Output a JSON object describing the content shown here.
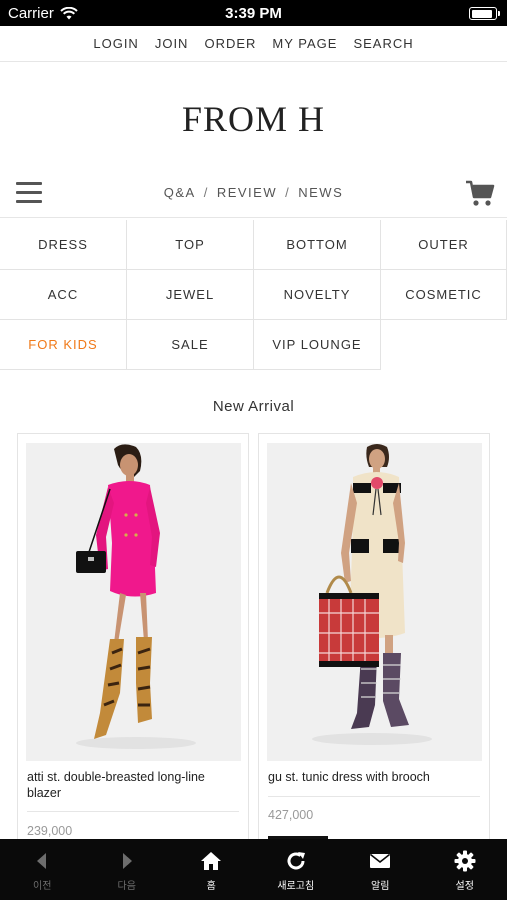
{
  "status_bar": {
    "carrier": "Carrier",
    "time": "3:39 PM",
    "battery_level": 0.9
  },
  "top_nav": [
    "LOGIN",
    "JOIN",
    "ORDER",
    "MY PAGE",
    "SEARCH"
  ],
  "logo": "FROM H",
  "sub_nav": {
    "links": [
      "Q&A",
      "REVIEW",
      "NEWS"
    ],
    "separator": "/"
  },
  "categories": [
    [
      "DRESS",
      "TOP",
      "BOTTOM",
      "OUTER"
    ],
    [
      "ACC",
      "JEWEL",
      "NOVELTY",
      "COSMETIC"
    ],
    [
      "FOR KIDS",
      "SALE",
      "VIP LOUNGE"
    ]
  ],
  "highlight_color": "#f07a1a",
  "section_title": "New Arrival",
  "products": [
    {
      "name": "atti st. double-breasted long-line blazer",
      "price": "239,000"
    },
    {
      "name": "gu st. tunic dress with brooch",
      "price": "427,000"
    }
  ],
  "toolbar": [
    {
      "icon": "back-arrow-icon",
      "label": "이전"
    },
    {
      "icon": "forward-arrow-icon",
      "label": "다음"
    },
    {
      "icon": "home-icon",
      "label": "홈"
    },
    {
      "icon": "refresh-icon",
      "label": "새로고침"
    },
    {
      "icon": "mail-icon",
      "label": "알림"
    },
    {
      "icon": "gear-icon",
      "label": "설정"
    }
  ]
}
